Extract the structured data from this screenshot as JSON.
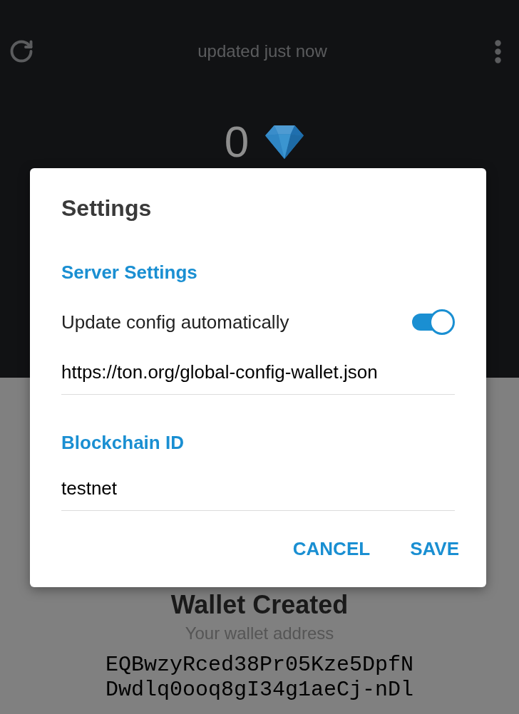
{
  "header": {
    "status": "updated just now"
  },
  "balance": {
    "amount": "0"
  },
  "wallet": {
    "title": "Wallet Created",
    "address_label": "Your wallet address",
    "address_lines": [
      "EQBwzyRced38Pr05Kze5DpfN",
      "Dwdlq0ooq8gI34g1aeCj-nDl"
    ]
  },
  "dialog": {
    "title": "Settings",
    "sections": [
      {
        "heading": "Server Settings",
        "toggle": {
          "label": "Update config automatically",
          "on": true
        },
        "field": {
          "value": "https://ton.org/global-config-wallet.json"
        }
      },
      {
        "heading": "Blockchain ID",
        "field": {
          "value": "testnet"
        }
      }
    ],
    "buttons": [
      "CANCEL",
      "SAVE"
    ]
  }
}
